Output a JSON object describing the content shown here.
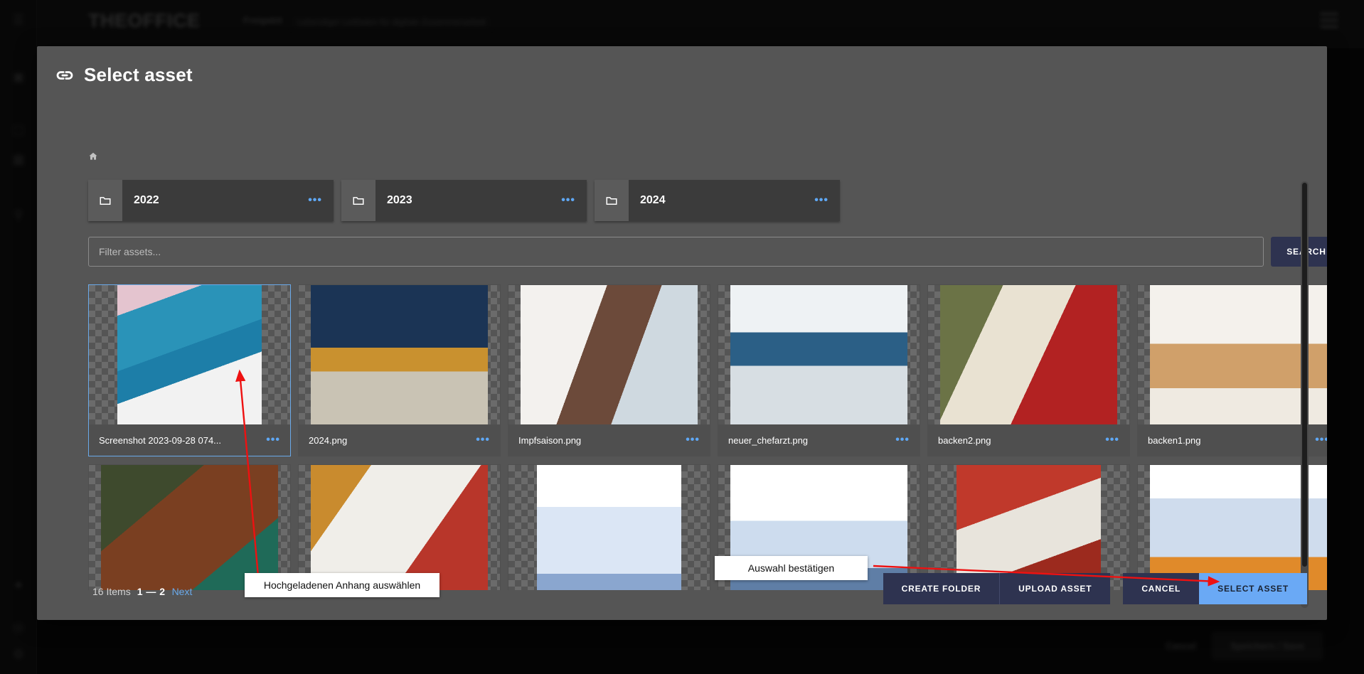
{
  "background": {
    "brand": "THEOFFICE",
    "brand_sub": "Freigabit",
    "brand_desc": "Lebendiger Leitfaden für digitale Zusammenarbeit",
    "menu_icon": "hamburger-icon",
    "sidebar_icons": [
      "grid-icon",
      "document-icon",
      "layers-icon",
      "image-icon",
      "search-icon",
      "user-icon",
      "help-icon",
      "settings-icon"
    ],
    "bottom_cancel": "Cancel",
    "bottom_primary": "Speichern / Save"
  },
  "modal": {
    "icon": "link-icon",
    "title": "Select asset",
    "breadcrumb_home_icon": "home-icon",
    "folders": [
      {
        "name": "2022",
        "icon": "folder-icon",
        "menu": "more-options-icon"
      },
      {
        "name": "2023",
        "icon": "folder-icon",
        "menu": "more-options-icon"
      },
      {
        "name": "2024",
        "icon": "folder-icon",
        "menu": "more-options-icon"
      }
    ],
    "search": {
      "placeholder": "Filter assets...",
      "button_label": "SEARCH"
    },
    "assets": [
      {
        "name": "Screenshot 2023-09-28 074...",
        "selected": true,
        "thumb": "medical-team-photo",
        "menu": "more-options-icon"
      },
      {
        "name": "2024.png",
        "selected": false,
        "thumb": "new-year-2024-photo",
        "menu": "more-options-icon"
      },
      {
        "name": "Impfsaison.png",
        "selected": false,
        "thumb": "vaccination-photo",
        "menu": "more-options-icon"
      },
      {
        "name": "neuer_chefarzt.png",
        "selected": false,
        "thumb": "doctor-portrait-photo",
        "menu": "more-options-icon"
      },
      {
        "name": "backen2.png",
        "selected": false,
        "thumb": "santa-reading-photo",
        "menu": "more-options-icon"
      },
      {
        "name": "backen1.png",
        "selected": false,
        "thumb": "gingerbread-cookies-photo",
        "menu": "more-options-icon"
      },
      {
        "name": "",
        "selected": false,
        "thumb": "christmas-crafting-photo",
        "menu": "more-options-icon"
      },
      {
        "name": "",
        "selected": false,
        "thumb": "recipe-vegetables-photo",
        "menu": "more-options-icon"
      },
      {
        "name": "",
        "selected": false,
        "thumb": "illustration-people-blue",
        "menu": "more-options-icon"
      },
      {
        "name": "",
        "selected": false,
        "thumb": "illustration-hand-ballot",
        "menu": "more-options-icon"
      },
      {
        "name": "",
        "selected": false,
        "thumb": "santa-letter-photo",
        "menu": "more-options-icon"
      },
      {
        "name": "",
        "selected": false,
        "thumb": "illustration-warning-screen",
        "menu": "more-options-icon"
      }
    ],
    "pager": {
      "items_count": "16 Items",
      "range": "1 — 2",
      "next": "Next"
    },
    "footer": {
      "create_folder": "CREATE FOLDER",
      "upload_asset": "UPLOAD ASSET",
      "cancel": "CANCEL",
      "select_asset": "SELECT ASSET"
    }
  },
  "annotations": {
    "select_asset_note": "Hochgeladenen Anhang auswählen",
    "confirm_note": "Auswahl bestätigen",
    "arrow_color": "#ee1111"
  },
  "colors": {
    "modal_bg": "#555555",
    "button_dark": "#2e3350",
    "button_primary": "#6aa9f5",
    "accent_link": "#6aa9e9",
    "page_bg": "#0b0b0b"
  }
}
